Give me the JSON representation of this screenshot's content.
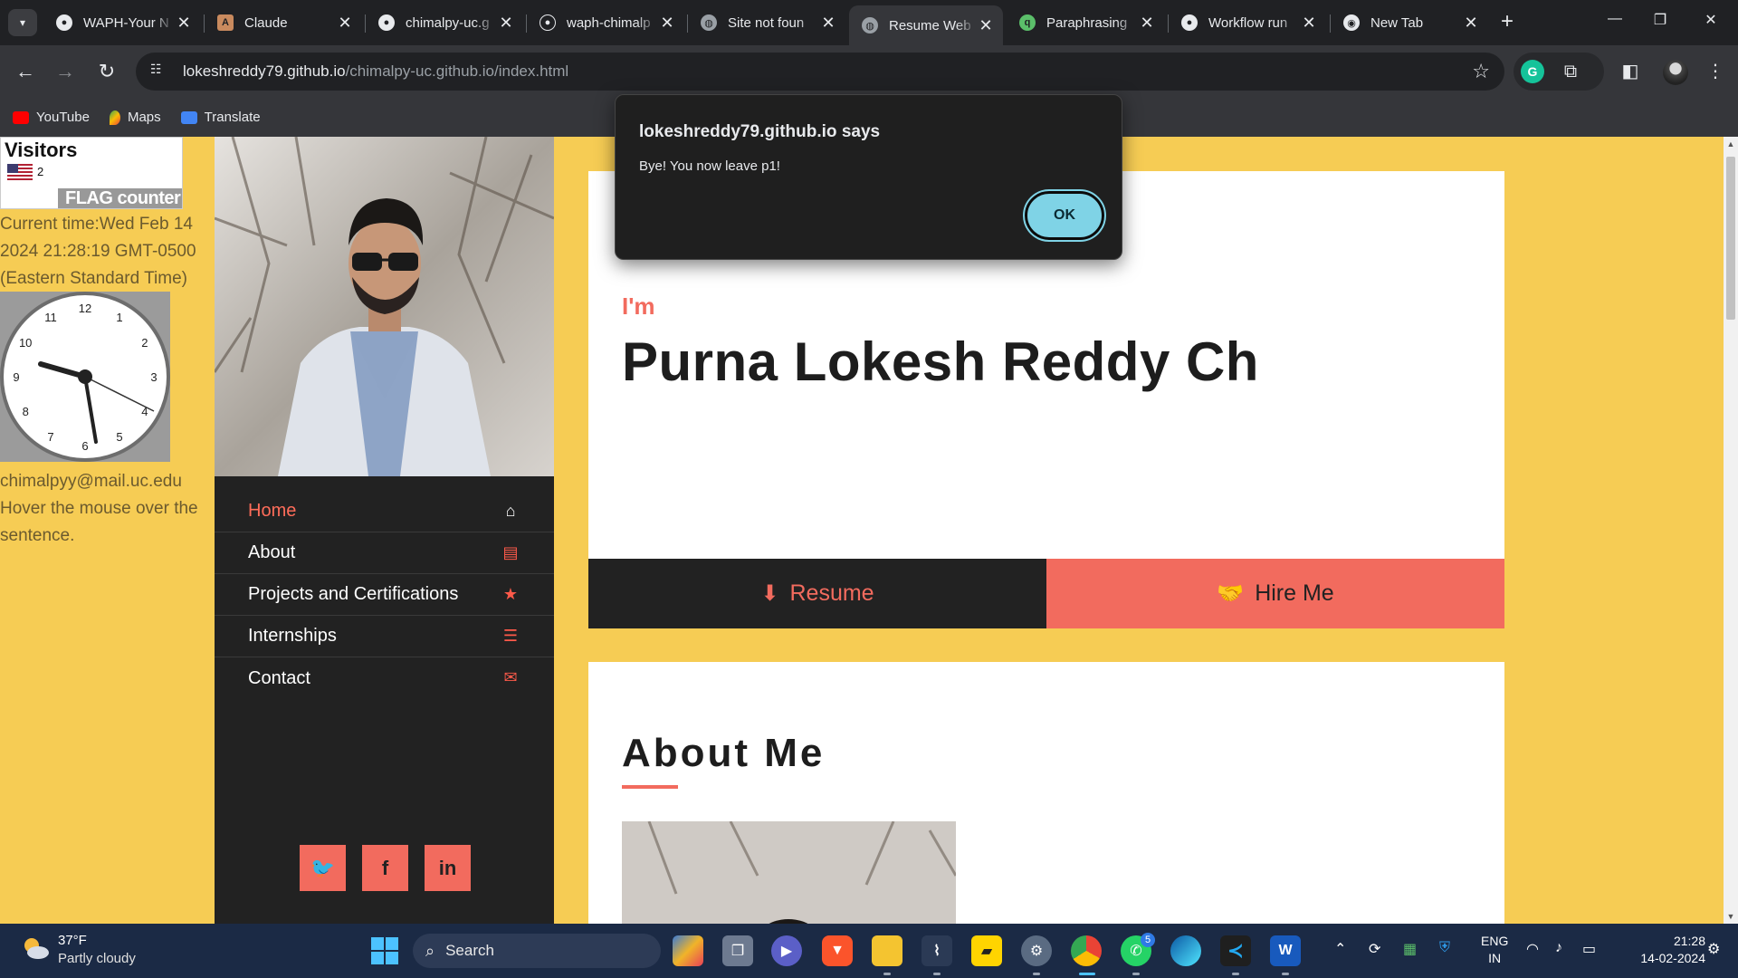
{
  "tabs": [
    {
      "title": "WAPH-Your N",
      "favicon": "github-icon",
      "active": false
    },
    {
      "title": "Claude",
      "favicon": "anthropic-icon",
      "active": false
    },
    {
      "title": "chimalpy-uc.g",
      "favicon": "github-icon",
      "active": false
    },
    {
      "title": "waph-chimalp",
      "favicon": "github-icon",
      "active": false
    },
    {
      "title": "Site not foun",
      "favicon": "globe-icon",
      "active": false
    },
    {
      "title": "Resume Web",
      "favicon": "globe-icon",
      "active": true
    },
    {
      "title": "Paraphrasing",
      "favicon": "paraphrase-icon",
      "active": false
    },
    {
      "title": "Workflow run",
      "favicon": "github-icon",
      "active": false
    },
    {
      "title": "New Tab",
      "favicon": "chrome-icon",
      "active": false
    }
  ],
  "address": {
    "host": "lokeshreddy79.github.io",
    "path": "/chimalpy-uc.github.io/index.html"
  },
  "bookmarks": [
    {
      "label": "YouTube",
      "icon": "youtube-icon",
      "color": "#ff0000"
    },
    {
      "label": "Maps",
      "icon": "maps-icon",
      "color": "#34a853"
    },
    {
      "label": "Translate",
      "icon": "translate-icon",
      "color": "#4285f4"
    }
  ],
  "left": {
    "visitors_title": "Visitors",
    "visitor_count": "2",
    "flag_counter_text": "FLAG counter",
    "current_time": "Current time:Wed Feb 14 2024 21:28:19 GMT-0500 (Eastern Standard Time)",
    "clock_numbers": [
      "12",
      "1",
      "2",
      "3",
      "4",
      "5",
      "6",
      "7",
      "8",
      "9",
      "10",
      "11"
    ],
    "email": "chimalpyy@mail.uc.edu",
    "hover_hint": "Hover the mouse over the sentence."
  },
  "nav": [
    {
      "label": "Home",
      "icon": "home-icon",
      "glyph": "⌂",
      "active": true
    },
    {
      "label": "About",
      "icon": "id-card-icon",
      "glyph": "▤",
      "active": false
    },
    {
      "label": "Projects and Certifications",
      "icon": "star-icon",
      "glyph": "★",
      "active": false
    },
    {
      "label": "Internships",
      "icon": "list-icon",
      "glyph": "☰",
      "active": false
    },
    {
      "label": "Contact",
      "icon": "envelope-icon",
      "glyph": "✉",
      "active": false
    }
  ],
  "social": [
    {
      "icon": "twitter-icon",
      "glyph": "🐦"
    },
    {
      "icon": "facebook-icon",
      "glyph": "f"
    },
    {
      "icon": "linkedin-icon",
      "glyph": "in"
    }
  ],
  "hero": {
    "intro": "I'm",
    "name": "Purna Lokesh Reddy Ch",
    "resume_label": "Resume",
    "hire_label": "Hire Me"
  },
  "about": {
    "title": "About Me"
  },
  "dialog": {
    "title": "lokeshreddy79.github.io says",
    "message": "Bye! You now leave p1!",
    "ok_label": "OK"
  },
  "taskbar": {
    "temperature": "37°F",
    "weather": "Partly cloudy",
    "search_placeholder": "Search",
    "whatsapp_badge": "5",
    "lang_line1": "ENG",
    "lang_line2": "IN",
    "time": "21:28",
    "date": "14-02-2024"
  },
  "colors": {
    "page_bg": "#f6cc54",
    "accent": "#f26b5e",
    "sidebar": "#222222",
    "dialog_button": "#7fd3e6"
  }
}
